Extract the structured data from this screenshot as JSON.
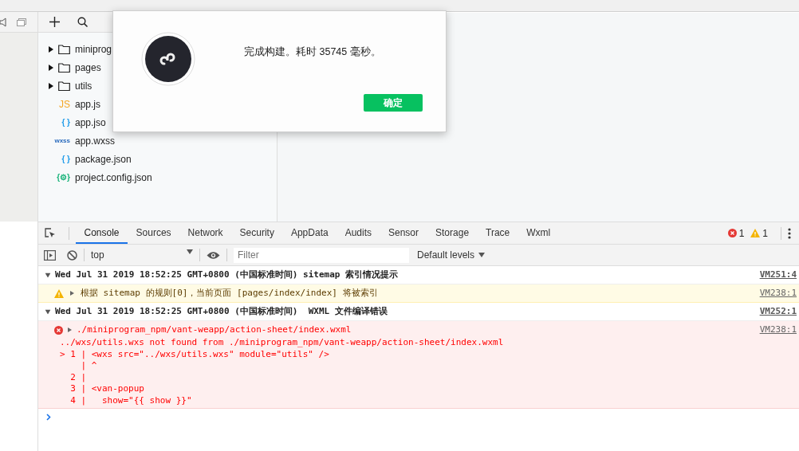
{
  "file_tree": {
    "items": [
      {
        "kind": "folder",
        "name": "miniprog",
        "expanded": false
      },
      {
        "kind": "folder",
        "name": "pages",
        "expanded": false
      },
      {
        "kind": "folder",
        "name": "utils",
        "expanded": false
      },
      {
        "kind": "js",
        "icon": "JS",
        "name": "app.js"
      },
      {
        "kind": "json",
        "icon": "{ }",
        "name": "app.jso"
      },
      {
        "kind": "wxss",
        "icon": "wxss",
        "name": "app.wxss"
      },
      {
        "kind": "json",
        "icon": "{ }",
        "name": "package.json"
      },
      {
        "kind": "config",
        "icon": "{⚙}",
        "name": "project.config.json"
      }
    ]
  },
  "dialog": {
    "message": "完成构建。耗时 35745 毫秒。",
    "button": "确定"
  },
  "devtools": {
    "tabs": [
      {
        "label": "Console",
        "selected": true
      },
      {
        "label": "Sources",
        "selected": false
      },
      {
        "label": "Network",
        "selected": false
      },
      {
        "label": "Security",
        "selected": false
      },
      {
        "label": "AppData",
        "selected": false
      },
      {
        "label": "Audits",
        "selected": false
      },
      {
        "label": "Sensor",
        "selected": false
      },
      {
        "label": "Storage",
        "selected": false
      },
      {
        "label": "Trace",
        "selected": false
      },
      {
        "label": "Wxml",
        "selected": false
      }
    ],
    "error_count": "1",
    "warning_count": "1",
    "context": "top",
    "filter": {
      "placeholder": "Filter"
    },
    "levels": "Default levels",
    "messages": [
      {
        "kind": "group",
        "expanded": true,
        "text": "Wed Jul 31 2019 18:52:25 GMT+0800 (中国标准时间) sitemap 索引情况提示",
        "source": "VM251:4"
      },
      {
        "kind": "warning",
        "expanded": false,
        "text": "根据 sitemap 的规则[0]，当前页面 [pages/index/index] 将被索引",
        "source": "VM238:1"
      },
      {
        "kind": "group",
        "expanded": true,
        "text": "Wed Jul 31 2019 18:52:25 GMT+0800 (中国标准时间)  WXML 文件编译错误",
        "source": "VM252:1"
      },
      {
        "kind": "error",
        "expanded": false,
        "text": "./miniprogram_npm/vant-weapp/action-sheet/index.wxml",
        "source": "VM238:1",
        "lines": [
          "../wxs/utils.wxs not found from ./miniprogram_npm/vant-weapp/action-sheet/index.wxml",
          "> 1 | <wxs src=\"../wxs/utils.wxs\" module=\"utils\" />",
          "    | ^",
          "  2 |",
          "  3 | <van-popup",
          "  4 |   show=\"{{ show }}\""
        ]
      }
    ]
  }
}
